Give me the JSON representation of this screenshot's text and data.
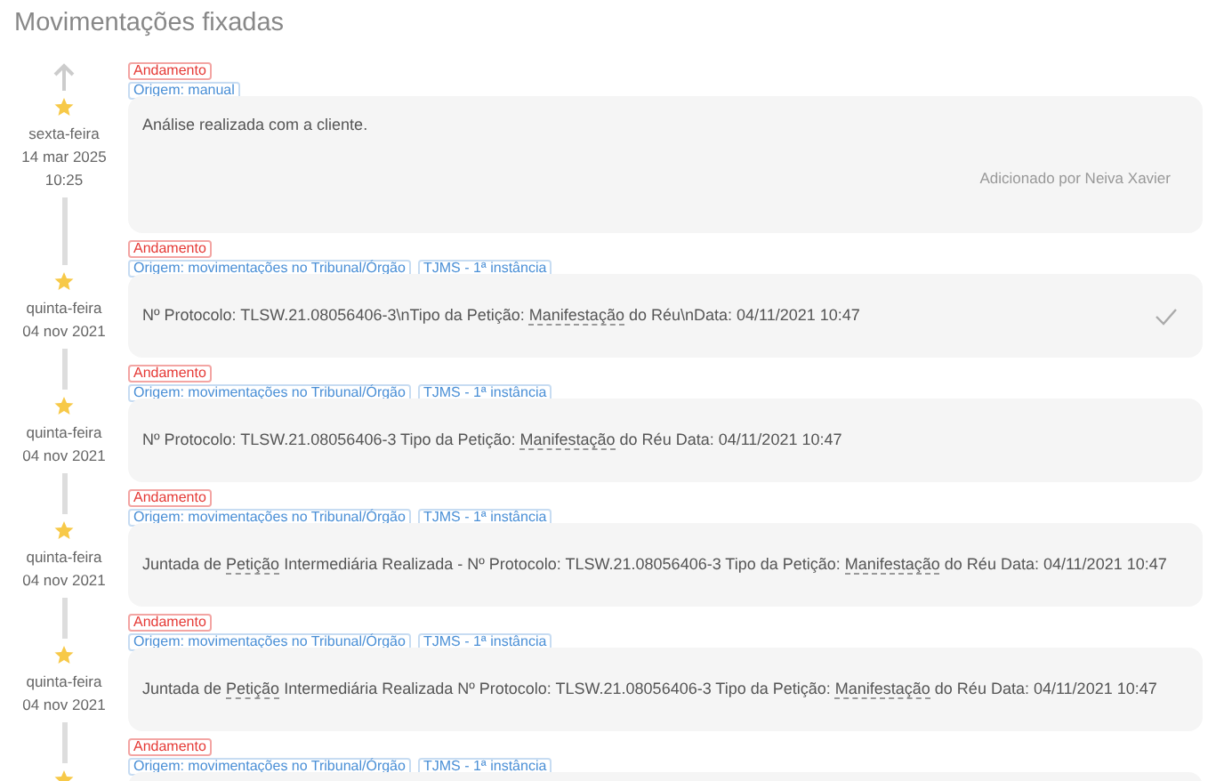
{
  "title": "Movimentações fixadas",
  "entries": [
    {
      "weekday": "sexta-feira",
      "date": "14 mar 2025",
      "time": "10:25",
      "top_arrow": true,
      "status_tag": "Andamento",
      "origin_tags": [
        "Origem: manual"
      ],
      "text_parts": [
        {
          "text": "Análise realizada com a cliente.",
          "underlined": false
        }
      ],
      "added_by": "Adicionado por Neiva Xavier",
      "checked": false
    },
    {
      "weekday": "quinta-feira",
      "date": "04 nov 2021",
      "top_arrow": false,
      "status_tag": "Andamento",
      "origin_tags": [
        "Origem: movimentações no Tribunal/Órgão",
        "TJMS - 1ª instância"
      ],
      "text_parts": [
        {
          "text": "Nº Protocolo: TLSW.21.08056406-3\\nTipo da Petição: ",
          "underlined": false
        },
        {
          "text": "Manifestação",
          "underlined": true
        },
        {
          "text": " do Réu\\nData: 04/11/2021 10:47",
          "underlined": false
        }
      ],
      "checked": true
    },
    {
      "weekday": "quinta-feira",
      "date": "04 nov 2021",
      "top_arrow": false,
      "status_tag": "Andamento",
      "origin_tags": [
        "Origem: movimentações no Tribunal/Órgão",
        "TJMS - 1ª instância"
      ],
      "text_parts": [
        {
          "text": "Nº Protocolo: TLSW.21.08056406-3 Tipo da Petição: ",
          "underlined": false
        },
        {
          "text": "Manifestação",
          "underlined": true
        },
        {
          "text": " do Réu Data: 04/11/2021 10:47",
          "underlined": false
        }
      ],
      "checked": false
    },
    {
      "weekday": "quinta-feira",
      "date": "04 nov 2021",
      "top_arrow": false,
      "status_tag": "Andamento",
      "origin_tags": [
        "Origem: movimentações no Tribunal/Órgão",
        "TJMS - 1ª instância"
      ],
      "text_parts": [
        {
          "text": "Juntada de ",
          "underlined": false
        },
        {
          "text": "Petição",
          "underlined": true
        },
        {
          "text": " Intermediária Realizada - Nº Protocolo: TLSW.21.08056406-3 Tipo da Petição: ",
          "underlined": false
        },
        {
          "text": "Manifestação",
          "underlined": true
        },
        {
          "text": " do Réu Data: 04/11/2021 10:47",
          "underlined": false
        }
      ],
      "checked": false
    },
    {
      "weekday": "quinta-feira",
      "date": "04 nov 2021",
      "top_arrow": false,
      "status_tag": "Andamento",
      "origin_tags": [
        "Origem: movimentações no Tribunal/Órgão",
        "TJMS - 1ª instância"
      ],
      "text_parts": [
        {
          "text": "Juntada de ",
          "underlined": false
        },
        {
          "text": "Petição",
          "underlined": true
        },
        {
          "text": " Intermediária Realizada Nº Protocolo: TLSW.21.08056406-3 Tipo da Petição: ",
          "underlined": false
        },
        {
          "text": "Manifestação",
          "underlined": true
        },
        {
          "text": " do Réu Data: 04/11/2021 10:47",
          "underlined": false
        }
      ],
      "checked": false
    },
    {
      "top_arrow": false,
      "status_tag": "Andamento",
      "origin_tags": [
        "Origem: movimentações no Tribunal/Órgão",
        "TJMS - 1ª instância"
      ],
      "checked": false
    }
  ]
}
